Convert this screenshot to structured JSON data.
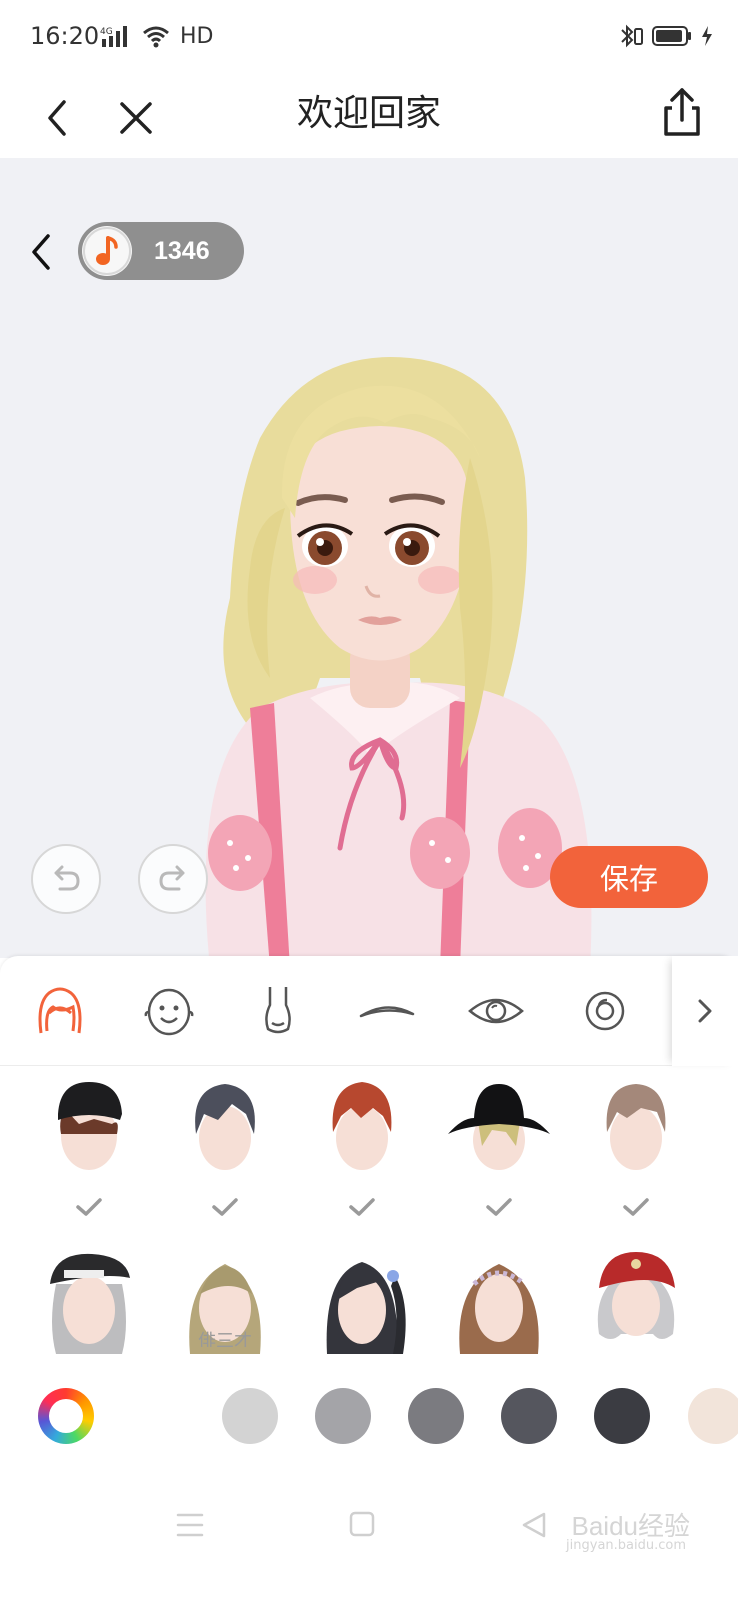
{
  "status_bar": {
    "time": "16:20",
    "network": "4G",
    "hd": "HD"
  },
  "nav": {
    "title": "欢迎回家"
  },
  "stage": {
    "coins": "1346"
  },
  "actions": {
    "save_label": "保存"
  },
  "categories": [
    {
      "name": "hairstyle",
      "icon": "hair-icon",
      "active": true
    },
    {
      "name": "face-shape",
      "icon": "face-icon",
      "active": false
    },
    {
      "name": "nose",
      "icon": "nose-icon",
      "active": false
    },
    {
      "name": "eyebrows",
      "icon": "eyebrow-icon",
      "active": false
    },
    {
      "name": "eyes",
      "icon": "eye-icon",
      "active": false
    },
    {
      "name": "pupil",
      "icon": "pupil-icon",
      "active": false
    }
  ],
  "hair_options_row1": [
    {
      "icon": "black-beanie-hair-icon",
      "checked": true
    },
    {
      "icon": "dark-grey-hair-icon",
      "checked": true
    },
    {
      "icon": "red-hair-icon",
      "checked": true
    },
    {
      "icon": "bucket-hat-blonde-hair-icon",
      "checked": true
    },
    {
      "icon": "light-brown-hair-icon",
      "checked": true
    }
  ],
  "hair_options_row2": [
    {
      "icon": "beret-silver-hair-icon",
      "label": ""
    },
    {
      "icon": "long-blonde-hair-icon",
      "label": "俳三才"
    },
    {
      "icon": "side-ponytail-hair-icon",
      "label": ""
    },
    {
      "icon": "flower-crown-hair-icon",
      "label": ""
    },
    {
      "icon": "red-hood-silver-hair-icon",
      "label": ""
    }
  ],
  "colors": {
    "accent": "#f2633b",
    "swatches": [
      "#d3d3d3",
      "#a4a4a8",
      "#7b7b80",
      "#55565e",
      "#3b3c42",
      "#f2e4da"
    ]
  },
  "watermark": {
    "main": "Baidu经验",
    "sub": "jingyan.baidu.com"
  }
}
